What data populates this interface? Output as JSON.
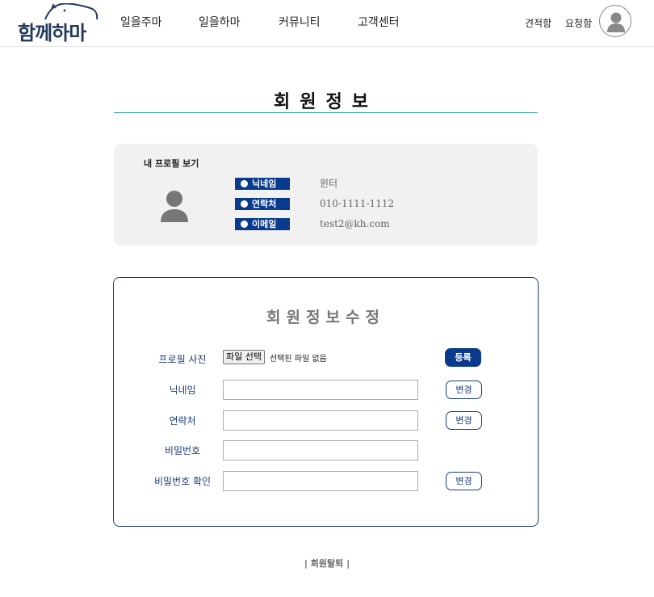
{
  "header": {
    "logo_text": "함께하마",
    "nav": [
      "일을주마",
      "일을하마",
      "커뮤니티",
      "고객센터"
    ],
    "links": {
      "quote": "견적함",
      "request": "요청함"
    }
  },
  "page_title": "회원정보",
  "profile": {
    "heading": "내 프로필 보기",
    "fields": [
      {
        "label": "닉네임",
        "value": "윈터"
      },
      {
        "label": "연락처",
        "value": "010-1111-1112"
      },
      {
        "label": "이메일",
        "value": "test2@kh.com"
      }
    ]
  },
  "edit": {
    "title": "회원정보수정",
    "photo_label": "프로필 사진",
    "file_button": "파일 선택",
    "file_status": "선택된 파일 없음",
    "register_label": "등록",
    "nickname_label": "닉네임",
    "phone_label": "연락처",
    "password_label": "비밀번호",
    "password_confirm_label": "비밀번호 확인",
    "change_label": "변경",
    "nickname_value": "",
    "phone_value": "",
    "password_value": "",
    "password_confirm_value": ""
  },
  "footer": {
    "withdraw": "| 회원탈퇴 |"
  },
  "colors": {
    "primary": "#0a3a8c",
    "accent_rule": "#2aa59a",
    "card_bg": "#f1f1f1"
  },
  "icons": {
    "avatar": "user-silhouette-icon",
    "logo_mascot": "hippo-outline-icon",
    "badge_dot": "dot-icon"
  }
}
